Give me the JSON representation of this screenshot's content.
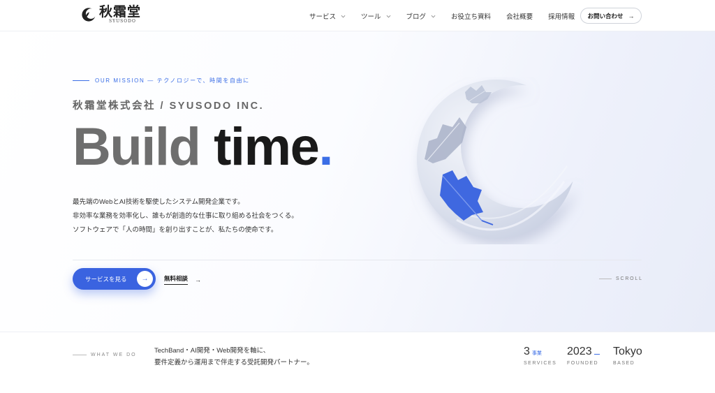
{
  "header": {
    "logo_text": "秋霜堂",
    "logo_subtext": "SYUSODO",
    "nav": [
      {
        "label": "サービス",
        "dropdown": true
      },
      {
        "label": "ツール",
        "dropdown": true
      },
      {
        "label": "ブログ",
        "dropdown": true
      },
      {
        "label": "お役立ち資料",
        "dropdown": false
      },
      {
        "label": "会社概要",
        "dropdown": false
      },
      {
        "label": "採用情報",
        "dropdown": false
      }
    ],
    "cta_label": "お問い合わせ",
    "cta_arrow": "→"
  },
  "hero": {
    "mission": "OUR MISSION — テクノロジーで、時間を自由に",
    "company": "秋霜堂株式会社 / SYUSODO INC.",
    "headline_word1": "Build",
    "headline_word2": "time",
    "headline_dot": ".",
    "description": [
      "最先端のWebとAI技術を駆使したシステム開発企業です。",
      "非効率な業務を効率化し、誰もが創造的な仕事に取り組める社会をつくる。",
      "ソフトウェアで「人の時間」を創り出すことが、私たちの使命です。"
    ],
    "primary_button": "サービスを見る",
    "primary_arrow": "→",
    "secondary_button": "無料相談",
    "secondary_arrow": "→",
    "scroll_label": "SCROLL"
  },
  "bottom": {
    "label": "WHAT WE DO",
    "text": [
      "TechBand・AI開発・Web開発を軸に、",
      "要件定義から運用まで伴走する受託開発パートナー。"
    ],
    "stats": [
      {
        "value": "3",
        "unit": "事業",
        "label": "SERVICES"
      },
      {
        "value": "2023",
        "unit": "",
        "label": "FOUNDED"
      },
      {
        "value": "Tokyo",
        "unit": "",
        "label": "BASED"
      }
    ]
  },
  "colors": {
    "accent": "#3b6ee6",
    "button": "#3a63e0",
    "headline_gray": "#6e6e6e",
    "headline_dark": "#1a1a1a"
  },
  "icons": [
    "logo-moon-leaf-icon",
    "chevron-down-icon",
    "arrow-right-icon",
    "crescent-moon-leaves-illustration"
  ]
}
